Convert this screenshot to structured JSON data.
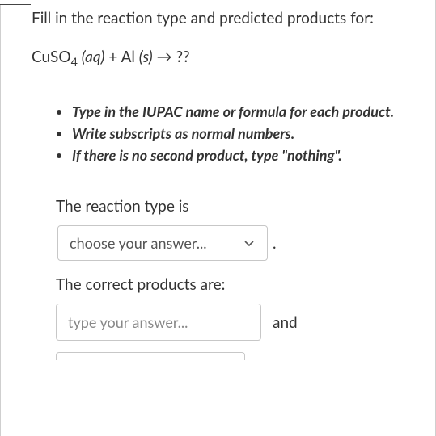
{
  "prompt": "Fill in the reaction type and predicted products for:",
  "equation": {
    "compound1": "CuSO",
    "sub1": "4",
    "state1": "(aq)",
    "plus": " + ",
    "compound2": "Al ",
    "state2": "(s)",
    "arrow": " → ",
    "unknown": "??"
  },
  "instructions": [
    "Type in the IUPAC name or formula for each product.",
    "Write subscripts as normal numbers.",
    "If there is no second product, type \"nothing\"."
  ],
  "reaction_label": "The reaction type is",
  "select_placeholder": "choose your answer...",
  "period": ".",
  "products_label": "The correct products are:",
  "input_placeholder": "type your answer...",
  "and": "and"
}
